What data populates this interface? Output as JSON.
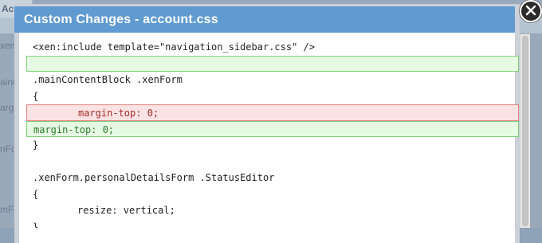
{
  "window": {
    "title": "Custom Changes - account.css"
  },
  "background": {
    "tab_label": "Accoun",
    "side_labels": [
      "xen:i",
      "ainC",
      "argi",
      "nFor",
      "mFor"
    ]
  },
  "code_lines": [
    {
      "text": "<xen:include template=\"navigation_sidebar.css\" />",
      "kind": "plain"
    },
    {
      "text": "",
      "kind": "added"
    },
    {
      "text": ".mainContentBlock .xenForm",
      "kind": "plain"
    },
    {
      "text": "{",
      "kind": "plain"
    },
    {
      "text": "margin-top: 0;",
      "kind": "removed"
    },
    {
      "text": "margin-top: 0;",
      "kind": "added"
    },
    {
      "text": "}",
      "kind": "plain"
    },
    {
      "text": "",
      "kind": "plain"
    },
    {
      "text": ".xenForm.personalDetailsForm .StatusEditor",
      "kind": "plain"
    },
    {
      "text": "{",
      "kind": "plain"
    },
    {
      "text": "resize: vertical;",
      "kind": "indented"
    },
    {
      "text": "}",
      "kind": "plain"
    }
  ],
  "colors": {
    "header": "#5f9ad0",
    "added_bg": "#e6f9e2",
    "removed_bg": "#fbe3e3"
  },
  "icons": {
    "close": "close-icon"
  }
}
